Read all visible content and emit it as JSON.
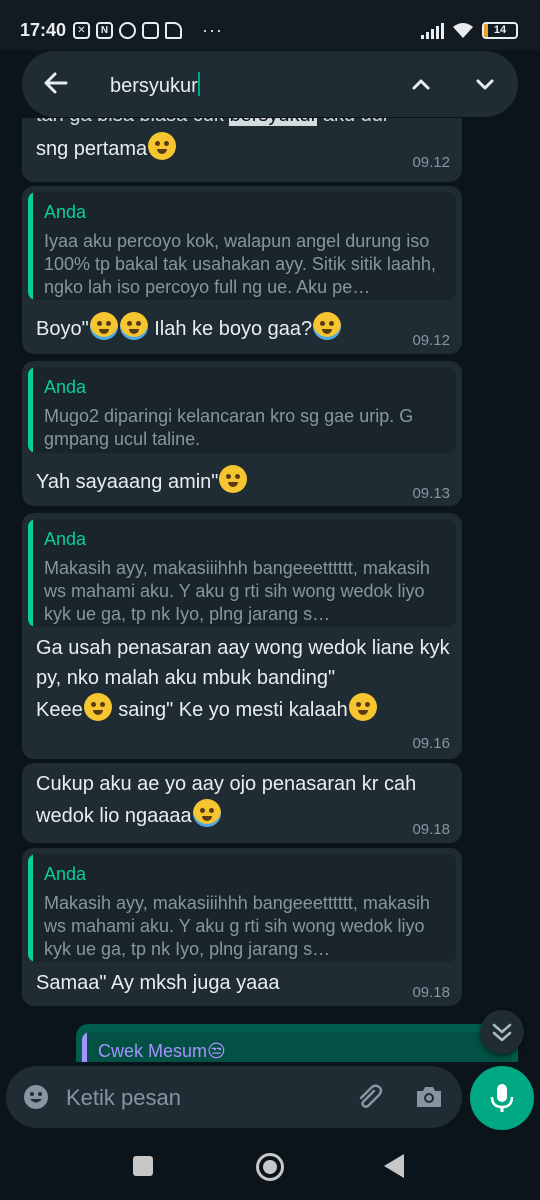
{
  "status_bar": {
    "time": "17:40",
    "more": "···",
    "battery": "14"
  },
  "search": {
    "query": "bersyukur"
  },
  "messages": [
    {
      "partial_top": "tan ga bisa biasa cuk bersyukur aku dul",
      "highlight": "bersyukur",
      "text": "sng pertama",
      "time": "09.12"
    },
    {
      "quote_author": "Anda",
      "quote_text": "Iyaa aku percoyo kok, walapun angel durung iso 100% tp bakal tak usahakan ayy. Sitik sitik laahh, ngko lah iso percoyo full ng ue. Aku pe…",
      "text_a": "Boyo\"",
      "text_b": " Ilah ke boyo gaa?",
      "time": "09.12"
    },
    {
      "quote_author": "Anda",
      "quote_text": "Mugo2 diparingi kelancaran kro sg gae urip. G gmpang ucul taline.",
      "text": "Yah sayaaang amin\"",
      "time": "09.13"
    },
    {
      "quote_author": "Anda",
      "quote_text": "Makasih ayy, makasiiihhh bangeeetttttt, makasih ws mahami aku. Y aku g rti sih wong wedok liyo kyk ue ga, tp nk Iyo, plng jarang s…",
      "text_a": "Ga usah penasaran aay wong wedok liane kyk py, nko malah aku mbuk banding\"",
      "text_b": "Keee",
      "text_c": " saing\" Ke yo mesti kalaah",
      "time": "09.16"
    },
    {
      "text_a": "Cukup aku ae yo aay ojo penasaran kr cah",
      "text_b": "wedok lio ngaaaa",
      "time": "09.18"
    },
    {
      "quote_author": "Anda",
      "quote_text": "Makasih ayy, makasiiihhh bangeeetttttt, makasih ws mahami aku. Y aku g rti sih wong wedok liyo kyk ue ga, tp nk Iyo, plng jarang s…",
      "text": "Samaa\" Ay mksh juga yaaa",
      "time": "09.18"
    },
    {
      "quote_author": "Cwek Mesum😒"
    }
  ],
  "composer": {
    "placeholder": "Ketik pesan"
  },
  "icons": {
    "back": "arrow-left",
    "up": "chevron-up",
    "down": "chevron-down",
    "emoji": "smiley",
    "attach": "paperclip",
    "camera": "camera",
    "mic": "microphone"
  },
  "colors": {
    "accent": "#00a884",
    "quote_author": "#06cf9c",
    "incoming_bubble": "#202c33",
    "outgoing_bubble": "#005c4b",
    "background": "#0b141a"
  }
}
